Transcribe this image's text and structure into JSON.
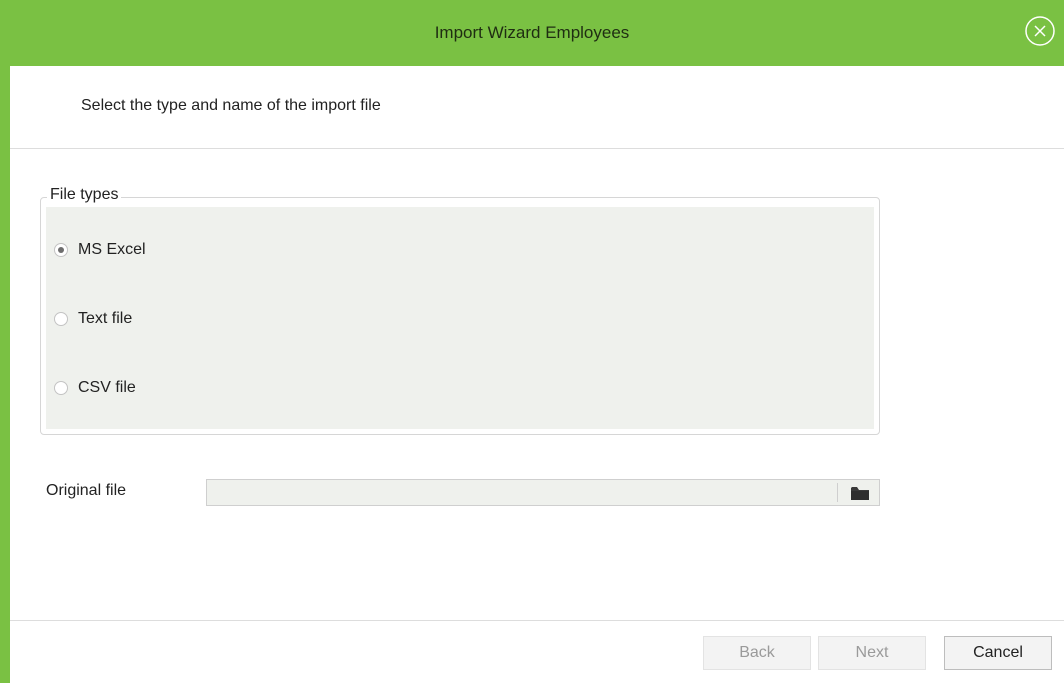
{
  "window": {
    "title": "Import Wizard Employees",
    "close_icon": "close-circle-icon",
    "accent_color": "#7ac143"
  },
  "header": {
    "subtitle": "Select the type and name of the import file"
  },
  "file_types": {
    "legend": "File types",
    "options": [
      {
        "label": "MS Excel",
        "checked": true
      },
      {
        "label": "Text file",
        "checked": false
      },
      {
        "label": "CSV file",
        "checked": false
      }
    ]
  },
  "original_file": {
    "label": "Original file",
    "value": "",
    "browse_icon": "folder-icon"
  },
  "footer": {
    "back_label": "Back",
    "next_label": "Next",
    "cancel_label": "Cancel"
  }
}
